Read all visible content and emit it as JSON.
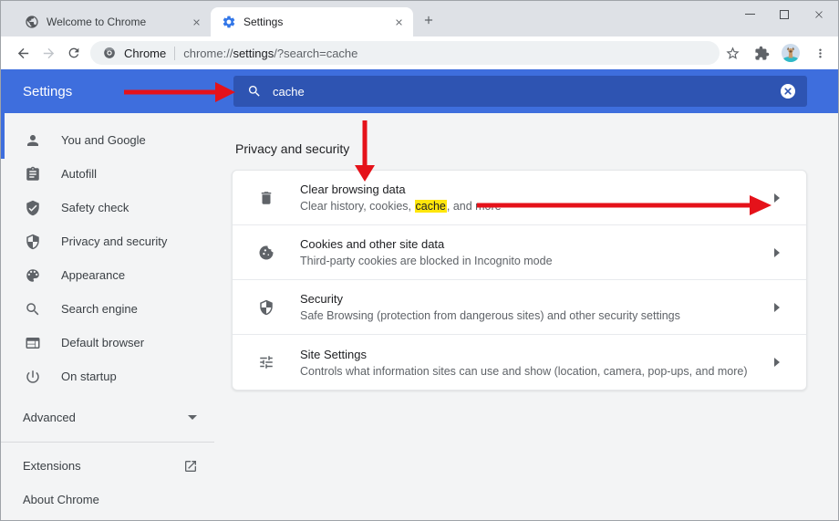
{
  "colors": {
    "header_blue": "#3e6edd",
    "search_box_blue": "#2e54b2",
    "arrow_red": "#e5121a",
    "highlight_yellow": "#ffe60c",
    "tabstrip_bg": "#dee1e6",
    "main_bg": "#f3f4f5",
    "text_primary": "#202124",
    "text_secondary": "#5f6368",
    "favicon_blue": "#3377e8"
  },
  "tabs": [
    {
      "title": "Welcome to Chrome"
    },
    {
      "title": "Settings"
    }
  ],
  "toolbar": {
    "url_app": "Chrome",
    "url_scheme": "chrome://",
    "url_host": "settings",
    "url_rest": "/?search=cache"
  },
  "settings_header": {
    "title": "Settings",
    "search_value": "cache"
  },
  "sidebar": {
    "items": [
      {
        "label": "You and Google"
      },
      {
        "label": "Autofill"
      },
      {
        "label": "Safety check"
      },
      {
        "label": "Privacy and security"
      },
      {
        "label": "Appearance"
      },
      {
        "label": "Search engine"
      },
      {
        "label": "Default browser"
      },
      {
        "label": "On startup"
      }
    ],
    "advanced": "Advanced",
    "extensions": "Extensions",
    "about": "About Chrome"
  },
  "content": {
    "section_title": "Privacy and security",
    "rows": [
      {
        "title": "Clear browsing data",
        "subtitle_pre": "Clear history, cookies, ",
        "subtitle_highlight": "cache",
        "subtitle_post": ", and more"
      },
      {
        "title": "Cookies and other site data",
        "subtitle": "Third-party cookies are blocked in Incognito mode"
      },
      {
        "title": "Security",
        "subtitle": "Safe Browsing (protection from dangerous sites) and other security settings"
      },
      {
        "title": "Site Settings",
        "subtitle": "Controls what information sites can use and show (location, camera, pop-ups, and more)"
      }
    ]
  }
}
